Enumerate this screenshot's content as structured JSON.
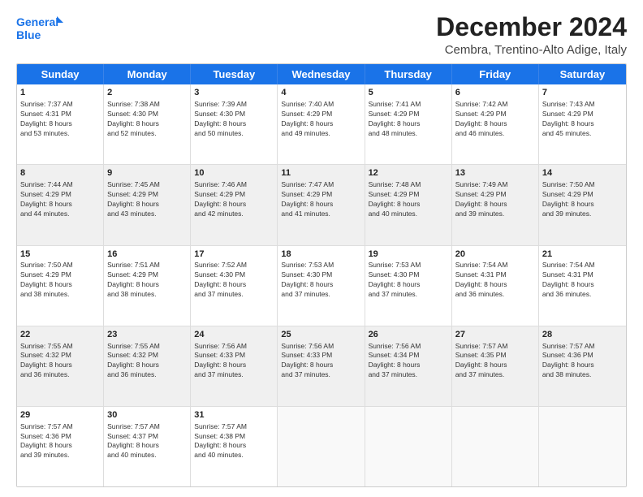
{
  "logo": {
    "line1": "General",
    "line2": "Blue"
  },
  "title": "December 2024",
  "subtitle": "Cembra, Trentino-Alto Adige, Italy",
  "headers": [
    "Sunday",
    "Monday",
    "Tuesday",
    "Wednesday",
    "Thursday",
    "Friday",
    "Saturday"
  ],
  "weeks": [
    [
      {
        "day": "1",
        "lines": [
          "Sunrise: 7:37 AM",
          "Sunset: 4:31 PM",
          "Daylight: 8 hours",
          "and 53 minutes."
        ],
        "shaded": false
      },
      {
        "day": "2",
        "lines": [
          "Sunrise: 7:38 AM",
          "Sunset: 4:30 PM",
          "Daylight: 8 hours",
          "and 52 minutes."
        ],
        "shaded": false
      },
      {
        "day": "3",
        "lines": [
          "Sunrise: 7:39 AM",
          "Sunset: 4:30 PM",
          "Daylight: 8 hours",
          "and 50 minutes."
        ],
        "shaded": false
      },
      {
        "day": "4",
        "lines": [
          "Sunrise: 7:40 AM",
          "Sunset: 4:29 PM",
          "Daylight: 8 hours",
          "and 49 minutes."
        ],
        "shaded": false
      },
      {
        "day": "5",
        "lines": [
          "Sunrise: 7:41 AM",
          "Sunset: 4:29 PM",
          "Daylight: 8 hours",
          "and 48 minutes."
        ],
        "shaded": false
      },
      {
        "day": "6",
        "lines": [
          "Sunrise: 7:42 AM",
          "Sunset: 4:29 PM",
          "Daylight: 8 hours",
          "and 46 minutes."
        ],
        "shaded": false
      },
      {
        "day": "7",
        "lines": [
          "Sunrise: 7:43 AM",
          "Sunset: 4:29 PM",
          "Daylight: 8 hours",
          "and 45 minutes."
        ],
        "shaded": false
      }
    ],
    [
      {
        "day": "8",
        "lines": [
          "Sunrise: 7:44 AM",
          "Sunset: 4:29 PM",
          "Daylight: 8 hours",
          "and 44 minutes."
        ],
        "shaded": true
      },
      {
        "day": "9",
        "lines": [
          "Sunrise: 7:45 AM",
          "Sunset: 4:29 PM",
          "Daylight: 8 hours",
          "and 43 minutes."
        ],
        "shaded": true
      },
      {
        "day": "10",
        "lines": [
          "Sunrise: 7:46 AM",
          "Sunset: 4:29 PM",
          "Daylight: 8 hours",
          "and 42 minutes."
        ],
        "shaded": true
      },
      {
        "day": "11",
        "lines": [
          "Sunrise: 7:47 AM",
          "Sunset: 4:29 PM",
          "Daylight: 8 hours",
          "and 41 minutes."
        ],
        "shaded": true
      },
      {
        "day": "12",
        "lines": [
          "Sunrise: 7:48 AM",
          "Sunset: 4:29 PM",
          "Daylight: 8 hours",
          "and 40 minutes."
        ],
        "shaded": true
      },
      {
        "day": "13",
        "lines": [
          "Sunrise: 7:49 AM",
          "Sunset: 4:29 PM",
          "Daylight: 8 hours",
          "and 39 minutes."
        ],
        "shaded": true
      },
      {
        "day": "14",
        "lines": [
          "Sunrise: 7:50 AM",
          "Sunset: 4:29 PM",
          "Daylight: 8 hours",
          "and 39 minutes."
        ],
        "shaded": true
      }
    ],
    [
      {
        "day": "15",
        "lines": [
          "Sunrise: 7:50 AM",
          "Sunset: 4:29 PM",
          "Daylight: 8 hours",
          "and 38 minutes."
        ],
        "shaded": false
      },
      {
        "day": "16",
        "lines": [
          "Sunrise: 7:51 AM",
          "Sunset: 4:29 PM",
          "Daylight: 8 hours",
          "and 38 minutes."
        ],
        "shaded": false
      },
      {
        "day": "17",
        "lines": [
          "Sunrise: 7:52 AM",
          "Sunset: 4:30 PM",
          "Daylight: 8 hours",
          "and 37 minutes."
        ],
        "shaded": false
      },
      {
        "day": "18",
        "lines": [
          "Sunrise: 7:53 AM",
          "Sunset: 4:30 PM",
          "Daylight: 8 hours",
          "and 37 minutes."
        ],
        "shaded": false
      },
      {
        "day": "19",
        "lines": [
          "Sunrise: 7:53 AM",
          "Sunset: 4:30 PM",
          "Daylight: 8 hours",
          "and 37 minutes."
        ],
        "shaded": false
      },
      {
        "day": "20",
        "lines": [
          "Sunrise: 7:54 AM",
          "Sunset: 4:31 PM",
          "Daylight: 8 hours",
          "and 36 minutes."
        ],
        "shaded": false
      },
      {
        "day": "21",
        "lines": [
          "Sunrise: 7:54 AM",
          "Sunset: 4:31 PM",
          "Daylight: 8 hours",
          "and 36 minutes."
        ],
        "shaded": false
      }
    ],
    [
      {
        "day": "22",
        "lines": [
          "Sunrise: 7:55 AM",
          "Sunset: 4:32 PM",
          "Daylight: 8 hours",
          "and 36 minutes."
        ],
        "shaded": true
      },
      {
        "day": "23",
        "lines": [
          "Sunrise: 7:55 AM",
          "Sunset: 4:32 PM",
          "Daylight: 8 hours",
          "and 36 minutes."
        ],
        "shaded": true
      },
      {
        "day": "24",
        "lines": [
          "Sunrise: 7:56 AM",
          "Sunset: 4:33 PM",
          "Daylight: 8 hours",
          "and 37 minutes."
        ],
        "shaded": true
      },
      {
        "day": "25",
        "lines": [
          "Sunrise: 7:56 AM",
          "Sunset: 4:33 PM",
          "Daylight: 8 hours",
          "and 37 minutes."
        ],
        "shaded": true
      },
      {
        "day": "26",
        "lines": [
          "Sunrise: 7:56 AM",
          "Sunset: 4:34 PM",
          "Daylight: 8 hours",
          "and 37 minutes."
        ],
        "shaded": true
      },
      {
        "day": "27",
        "lines": [
          "Sunrise: 7:57 AM",
          "Sunset: 4:35 PM",
          "Daylight: 8 hours",
          "and 37 minutes."
        ],
        "shaded": true
      },
      {
        "day": "28",
        "lines": [
          "Sunrise: 7:57 AM",
          "Sunset: 4:36 PM",
          "Daylight: 8 hours",
          "and 38 minutes."
        ],
        "shaded": true
      }
    ],
    [
      {
        "day": "29",
        "lines": [
          "Sunrise: 7:57 AM",
          "Sunset: 4:36 PM",
          "Daylight: 8 hours",
          "and 39 minutes."
        ],
        "shaded": false
      },
      {
        "day": "30",
        "lines": [
          "Sunrise: 7:57 AM",
          "Sunset: 4:37 PM",
          "Daylight: 8 hours",
          "and 40 minutes."
        ],
        "shaded": false
      },
      {
        "day": "31",
        "lines": [
          "Sunrise: 7:57 AM",
          "Sunset: 4:38 PM",
          "Daylight: 8 hours",
          "and 40 minutes."
        ],
        "shaded": false
      },
      {
        "day": "",
        "lines": [],
        "shaded": false,
        "empty": true
      },
      {
        "day": "",
        "lines": [],
        "shaded": false,
        "empty": true
      },
      {
        "day": "",
        "lines": [],
        "shaded": false,
        "empty": true
      },
      {
        "day": "",
        "lines": [],
        "shaded": false,
        "empty": true
      }
    ]
  ]
}
